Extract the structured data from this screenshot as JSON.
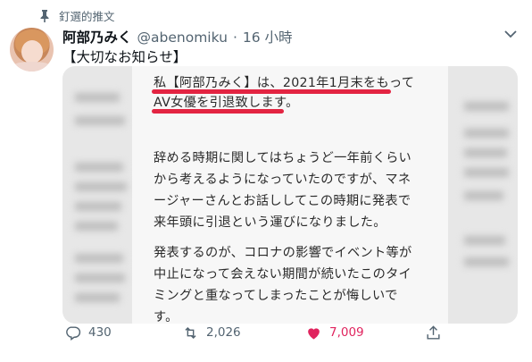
{
  "pinned_label": "釘選的推文",
  "author": {
    "name": "阿部乃みく",
    "handle": "@abenomiku",
    "separator": "·",
    "time": "16 小時"
  },
  "tweet_text": "【大切なお知らせ】",
  "image_text": {
    "lines": [
      "私【阿部乃みく】は、2021年1月末をもって",
      "AV女優を引退致します。",
      "辞める時期に関してはちょうど一年前くらい",
      "から考えるようになっていたのですが、マネ",
      "ージャーさんとお話ししてこの時期に発表で",
      "来年頭に引退という運びになりました。",
      "発表するのが、コロナの影響でイベント等が",
      "中止になって会えない期間が続いたこのタイ",
      "ミングと重なってしまったことが悔しいで",
      "す。"
    ]
  },
  "actions": {
    "reply_count": "430",
    "retweet_count": "2,026",
    "like_count": "7,009"
  },
  "colors": {
    "like": "#e0245e",
    "underline": "#e32442",
    "muted": "#536471"
  }
}
